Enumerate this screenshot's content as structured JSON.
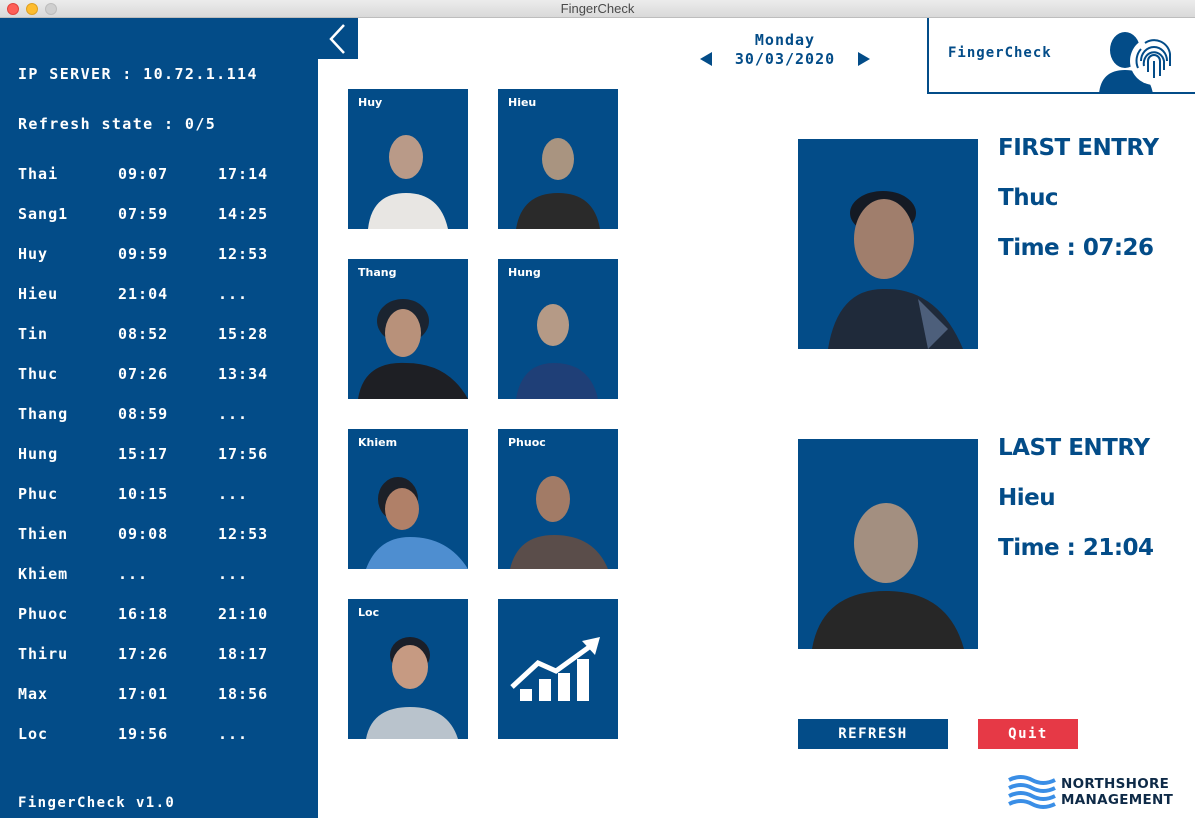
{
  "window": {
    "title": "FingerCheck"
  },
  "sidebar": {
    "ip_server": "IP SERVER : 10.72.1.114",
    "refresh_state": "Refresh state : 0/5",
    "attendance": [
      {
        "name": "Thai",
        "check_in": "09:07",
        "check_out": "17:14"
      },
      {
        "name": "Sang1",
        "check_in": "07:59",
        "check_out": "14:25"
      },
      {
        "name": "Huy",
        "check_in": "09:59",
        "check_out": "12:53"
      },
      {
        "name": "Hieu",
        "check_in": "21:04",
        "check_out": "..."
      },
      {
        "name": "Tin",
        "check_in": "08:52",
        "check_out": "15:28"
      },
      {
        "name": "Thuc",
        "check_in": "07:26",
        "check_out": "13:34"
      },
      {
        "name": "Thang",
        "check_in": "08:59",
        "check_out": "..."
      },
      {
        "name": "Hung",
        "check_in": "15:17",
        "check_out": "17:56"
      },
      {
        "name": "Phuc",
        "check_in": "10:15",
        "check_out": "..."
      },
      {
        "name": "Thien",
        "check_in": "09:08",
        "check_out": "12:53"
      },
      {
        "name": "Khiem",
        "check_in": "...",
        "check_out": "..."
      },
      {
        "name": "Phuoc",
        "check_in": "16:18",
        "check_out": "21:10"
      },
      {
        "name": "Thiru",
        "check_in": "17:26",
        "check_out": "18:17"
      },
      {
        "name": "Max",
        "check_in": "17:01",
        "check_out": "18:56"
      },
      {
        "name": "Loc",
        "check_in": "19:56",
        "check_out": "..."
      }
    ],
    "version": "FingerCheck v1.0"
  },
  "header": {
    "day": "Monday",
    "date": "30/03/2020",
    "app_name": "FingerCheck"
  },
  "employees": [
    "Huy",
    "Hieu",
    "Thang",
    "Hung",
    "Khiem",
    "Phuoc",
    "Loc"
  ],
  "first_entry": {
    "heading": "FIRST ENTRY",
    "name": "Thuc",
    "time": "Time : 07:26"
  },
  "last_entry": {
    "heading": "LAST ENTRY",
    "name": "Hieu",
    "time": "Time : 21:04"
  },
  "buttons": {
    "refresh": "REFRESH",
    "quit": "Quit"
  },
  "company": {
    "line1": "NORTHSHORE",
    "line2": "MANAGEMENT"
  },
  "colors": {
    "brand": "#034c88",
    "quit": "#e63946",
    "company_wave": "#3a8ee6"
  },
  "icons": {
    "back": "chevron-left-icon",
    "prev_date": "triangle-left-icon",
    "next_date": "triangle-right-icon",
    "logo": "person-fingerprint-icon",
    "stats": "growth-chart-icon"
  }
}
